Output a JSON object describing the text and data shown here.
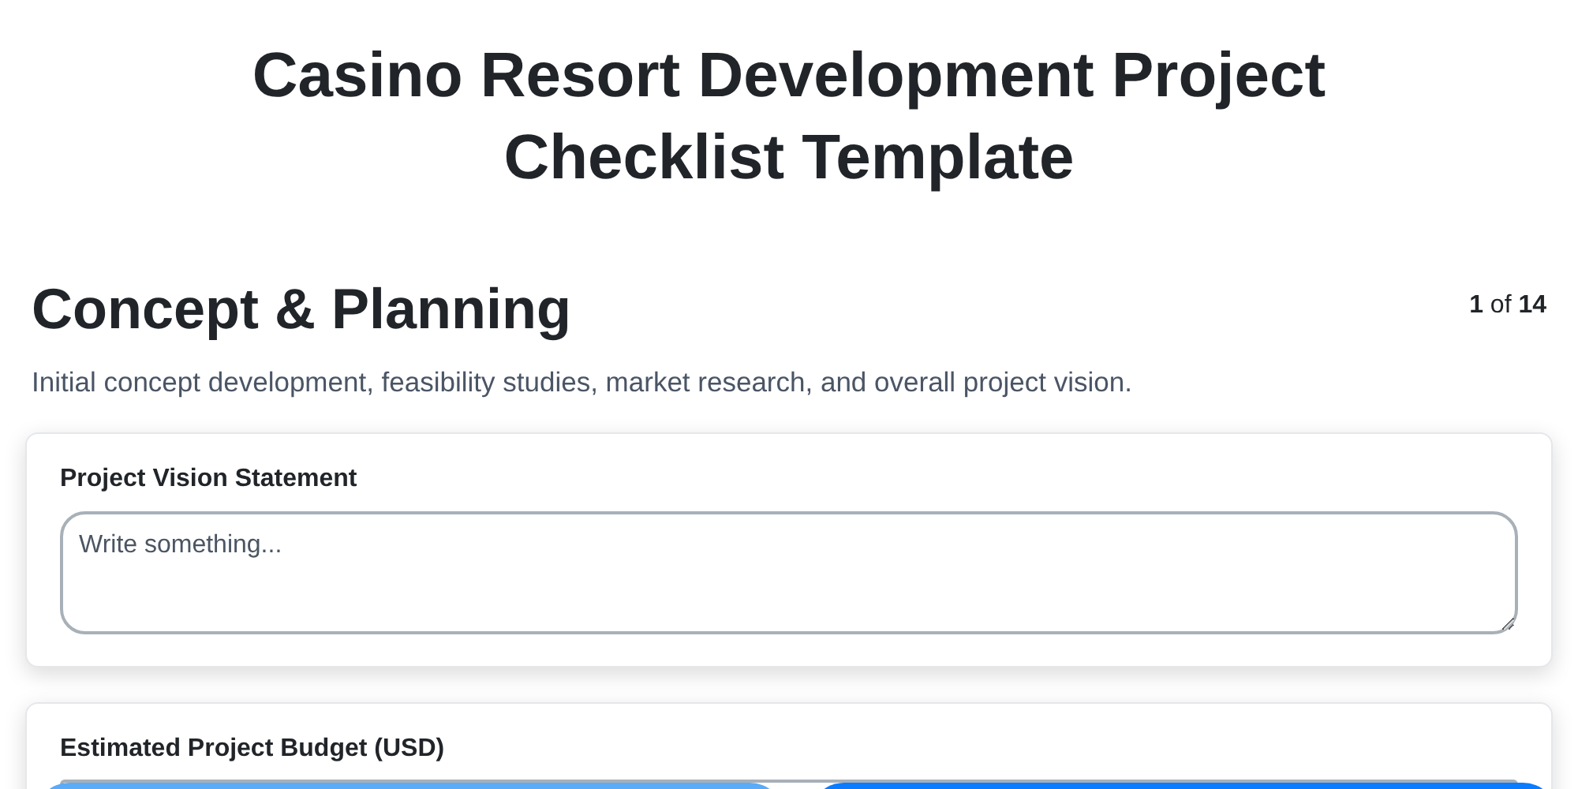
{
  "title": "Casino Resort Development Project Checklist Template",
  "section": {
    "heading": "Concept & Planning",
    "counter": {
      "current": "1",
      "separator": "of",
      "total": "14"
    },
    "description": "Initial concept development, feasibility studies, market research, and overall project vision."
  },
  "fields": [
    {
      "kind": "textarea",
      "label": "Project Vision Statement",
      "placeholder": "Write something..."
    },
    {
      "kind": "input",
      "label": "Estimated Project Budget (USD)"
    }
  ],
  "footer_buttons": [
    {
      "kind": "secondary"
    },
    {
      "kind": "primary"
    }
  ]
}
